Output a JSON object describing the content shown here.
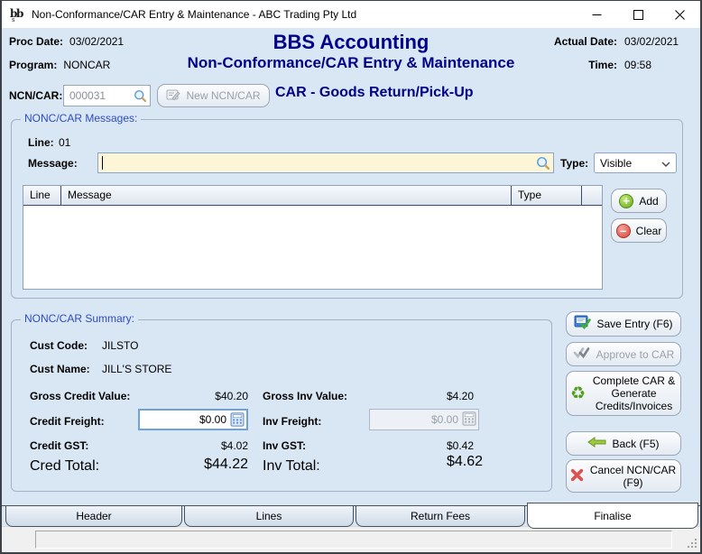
{
  "window": {
    "title": "Non-Conformance/CAR Entry & Maintenance - ABC Trading Pty Ltd"
  },
  "header": {
    "proc_date_label": "Proc Date:",
    "proc_date": "03/02/2021",
    "program_label": "Program:",
    "program": "NONCAR",
    "app_title": "BBS Accounting",
    "app_subtitle": "Non-Conformance/CAR Entry & Maintenance",
    "actual_date_label": "Actual Date:",
    "actual_date": "03/02/2021",
    "time_label": "Time:",
    "time": "09:58"
  },
  "ncn_bar": {
    "label": "NCN/CAR:",
    "value": "000031",
    "new_button_label": "New NCN/CAR",
    "mode_title": "CAR - Goods Return/Pick-Up"
  },
  "messages": {
    "group_title": "NONC/CAR Messages:",
    "line_label": "Line:",
    "line_value": "01",
    "message_label": "Message:",
    "message_value": "",
    "type_label": "Type:",
    "type_value": "Visible",
    "table": {
      "columns": [
        "Line",
        "Message",
        "Type",
        ""
      ],
      "rows": []
    },
    "add_button": "Add",
    "clear_button": "Clear"
  },
  "summary": {
    "group_title": "NONC/CAR Summary:",
    "cust_code_label": "Cust Code:",
    "cust_code": "JILSTO",
    "cust_name_label": "Cust Name:",
    "cust_name": "JILL'S STORE",
    "gross_credit_label": "Gross Credit Value:",
    "gross_credit": "$40.20",
    "credit_freight_label": "Credit Freight:",
    "credit_freight": "$0.00",
    "credit_gst_label": "Credit GST:",
    "credit_gst": "$4.02",
    "cred_total_label": "Cred Total:",
    "cred_total": "$44.22",
    "gross_inv_label": "Gross Inv Value:",
    "gross_inv": "$4.20",
    "inv_freight_label": "Inv Freight:",
    "inv_freight": "$0.00",
    "inv_gst_label": "Inv GST:",
    "inv_gst": "$0.42",
    "inv_total_label": "Inv Total:",
    "inv_total": "$4.62"
  },
  "actions": {
    "save": "Save Entry (F6)",
    "approve": "Approve to CAR",
    "complete": "Complete CAR & Generate Credits/Invoices",
    "back": "Back (F5)",
    "cancel": "Cancel NCN/CAR (F9)"
  },
  "tabs": [
    {
      "label": "Header",
      "active": false
    },
    {
      "label": "Lines",
      "active": false
    },
    {
      "label": "Return Fees",
      "active": false
    },
    {
      "label": "Finalise",
      "active": true
    }
  ],
  "colors": {
    "client_bg": "#d9e6f3",
    "navy_title": "#00008B",
    "group_label": "#2e4cc3",
    "message_field_bg": "#fcf5d8",
    "add_green": "#64ac18",
    "clear_red": "#d9443a",
    "cancel_red": "#d9534f",
    "back_green": "#9ccb3b"
  }
}
